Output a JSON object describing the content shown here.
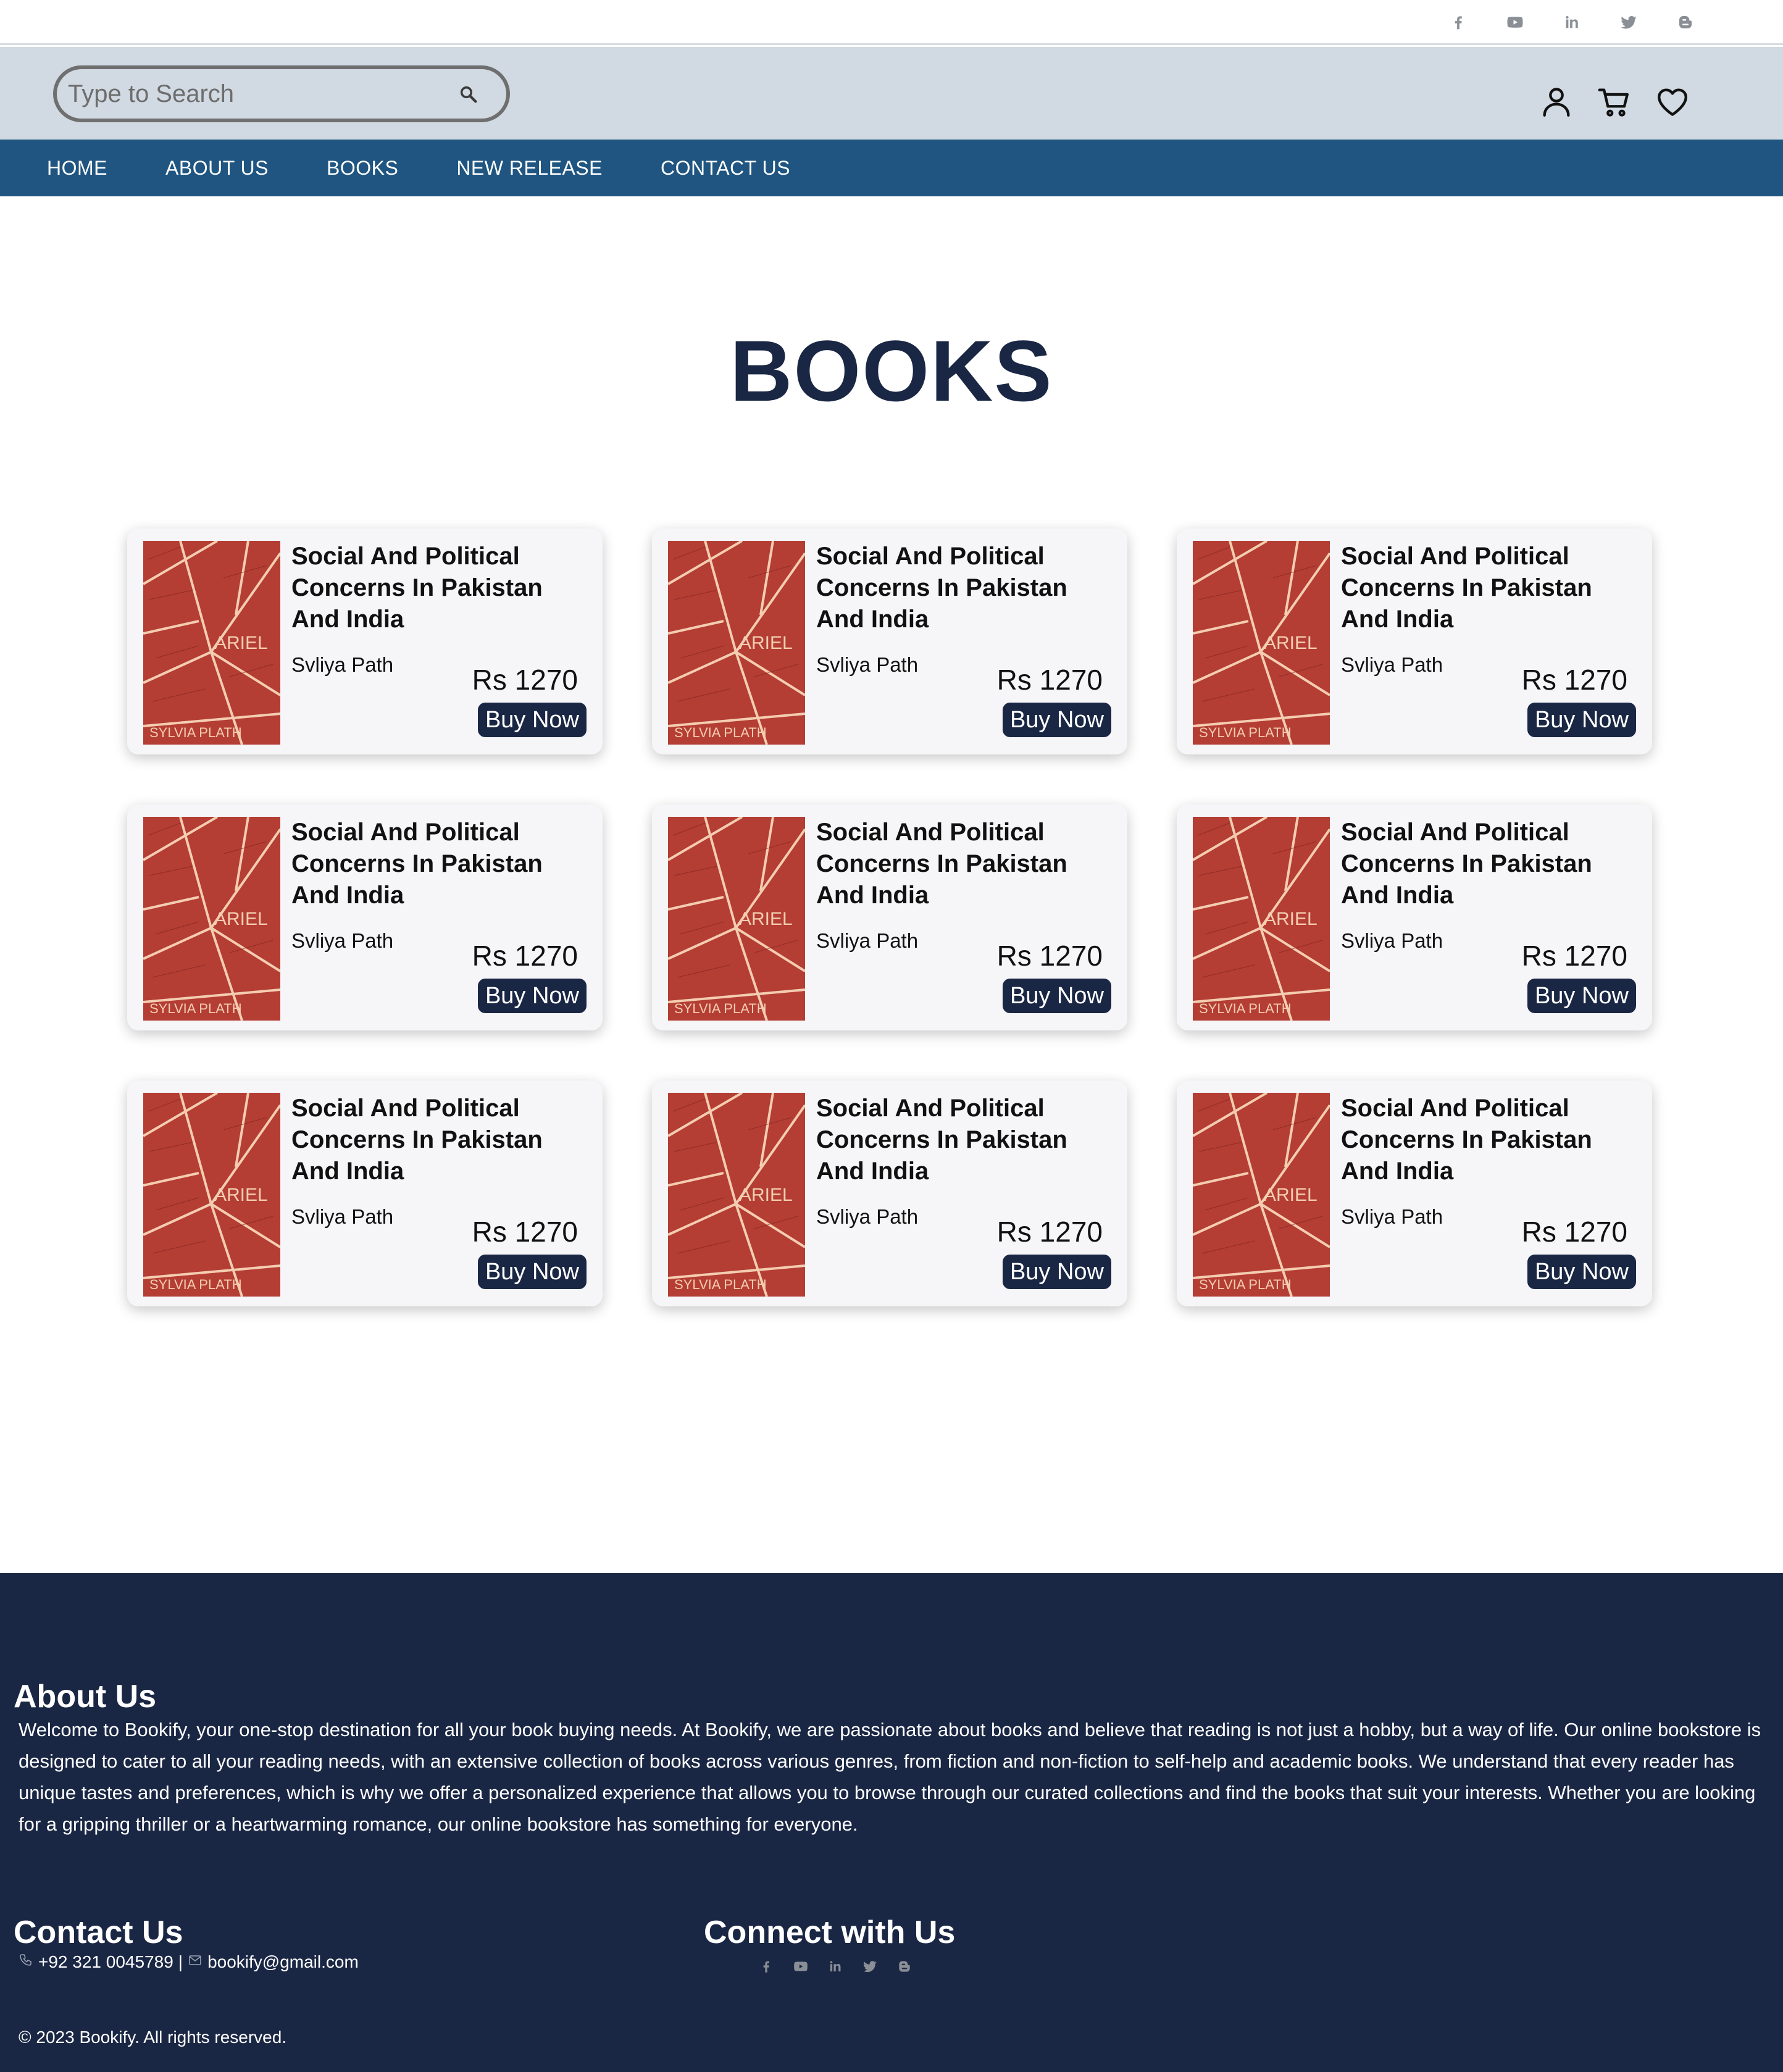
{
  "social_links": [
    {
      "icon": "facebook-icon"
    },
    {
      "icon": "youtube-icon"
    },
    {
      "icon": "linkedin-icon"
    },
    {
      "icon": "twitter-icon"
    },
    {
      "icon": "blogger-icon"
    }
  ],
  "header": {
    "search_placeholder": "Type to Search",
    "icons": [
      "user-icon",
      "cart-icon",
      "heart-icon"
    ]
  },
  "nav": {
    "items": [
      "HOME",
      "ABOUT US",
      "BOOKS",
      "NEW RELEASE",
      "CONTACT US"
    ]
  },
  "page": {
    "title": "BOOKS"
  },
  "books": [
    {
      "title": "Social And Political Concerns In Pakistan And India",
      "author": "Svliya Path",
      "price": "Rs 1270",
      "buy_label": "Buy Now",
      "cover_text_1": "ARIEL",
      "cover_text_2": "SYLVIA PLATH"
    },
    {
      "title": "Social And Political Concerns In Pakistan And India",
      "author": "Svliya Path",
      "price": "Rs 1270",
      "buy_label": "Buy Now",
      "cover_text_1": "ARIEL",
      "cover_text_2": "SYLVIA PLATH"
    },
    {
      "title": "Social And Political Concerns In Pakistan And India",
      "author": "Svliya Path",
      "price": "Rs 1270",
      "buy_label": "Buy Now",
      "cover_text_1": "ARIEL",
      "cover_text_2": "SYLVIA PLATH"
    },
    {
      "title": "Social And Political Concerns In Pakistan And India",
      "author": "Svliya Path",
      "price": "Rs 1270",
      "buy_label": "Buy Now",
      "cover_text_1": "ARIEL",
      "cover_text_2": "SYLVIA PLATH"
    },
    {
      "title": "Social And Political Concerns In Pakistan And India",
      "author": "Svliya Path",
      "price": "Rs 1270",
      "buy_label": "Buy Now",
      "cover_text_1": "ARIEL",
      "cover_text_2": "SYLVIA PLATH"
    },
    {
      "title": "Social And Political Concerns In Pakistan And India",
      "author": "Svliya Path",
      "price": "Rs 1270",
      "buy_label": "Buy Now",
      "cover_text_1": "ARIEL",
      "cover_text_2": "SYLVIA PLATH"
    },
    {
      "title": "Social And Political Concerns In Pakistan And India",
      "author": "Svliya Path",
      "price": "Rs 1270",
      "buy_label": "Buy Now",
      "cover_text_1": "ARIEL",
      "cover_text_2": "SYLVIA PLATH"
    },
    {
      "title": "Social And Political Concerns In Pakistan And India",
      "author": "Svliya Path",
      "price": "Rs 1270",
      "buy_label": "Buy Now",
      "cover_text_1": "ARIEL",
      "cover_text_2": "SYLVIA PLATH"
    },
    {
      "title": "Social And Political Concerns In Pakistan And India",
      "author": "Svliya Path",
      "price": "Rs 1270",
      "buy_label": "Buy Now",
      "cover_text_1": "ARIEL",
      "cover_text_2": "SYLVIA PLATH"
    }
  ],
  "footer": {
    "about_title": "About Us",
    "about_text": "Welcome to Bookify, your one-stop destination for all your book buying needs. At Bookify, we are passionate about books and believe that reading is not just a hobby, but a way of life. Our online bookstore is designed to cater to all your reading needs, with an extensive collection of books across various genres, from fiction and non-fiction to self-help and academic books. We understand that every reader has unique tastes and preferences, which is why we offer a personalized experience that allows you to browse through our curated collections and find the books that suit your interests. Whether you are looking for a gripping thriller or a heartwarming romance, our online bookstore has something for everyone.",
    "contact_title": "Contact Us",
    "phone": "+92 321 0045789",
    "separator": "|",
    "email": "bookify@gmail.com",
    "connect_title": "Connect with Us",
    "copyright": "© 2023 Bookify. All rights reserved."
  },
  "colors": {
    "nav_bg": "#1f5580",
    "header_bg": "#d1d9e2",
    "footer_bg": "#1a2744",
    "title_color": "#1a2744",
    "button_bg": "#1a2744",
    "cover_red": "#b43d34"
  }
}
